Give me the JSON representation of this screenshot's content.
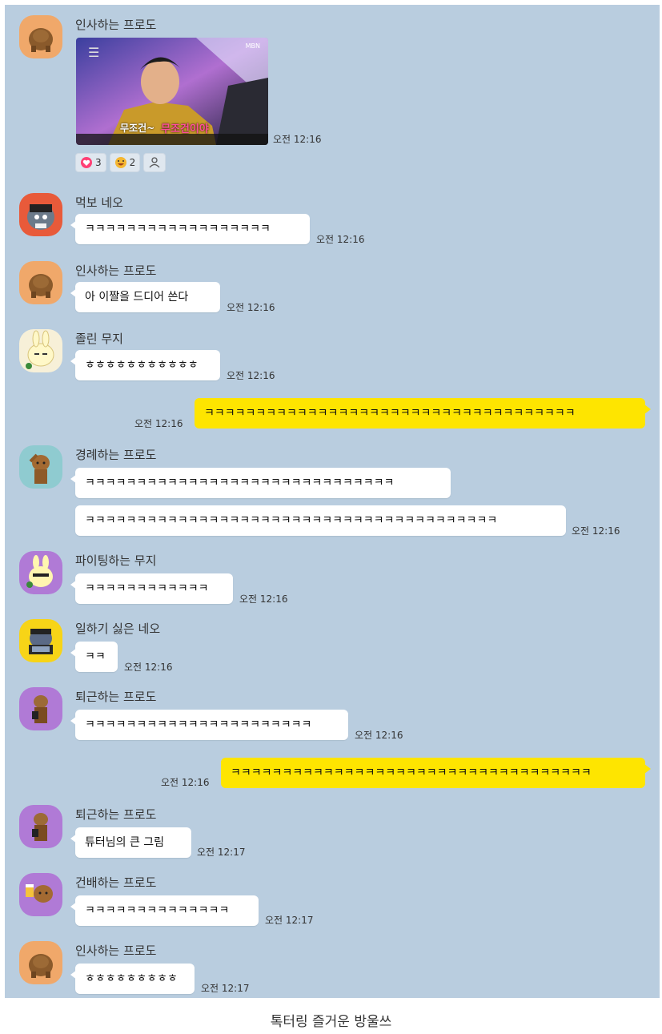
{
  "colors": {
    "chat_bg": "#b9cddf",
    "my_bubble": "#fee500",
    "other_bubble": "#ffffff"
  },
  "messages": [
    {
      "sender": "인사하는 프로도",
      "avatar": "frodo-greeting-avatar",
      "time": "오전 12:16",
      "image": {
        "caption_left": "무조건~",
        "caption_right": "무조건이야",
        "corner_badge": "MBN"
      }
    },
    {
      "sender": "먹보 네오",
      "text": "ㅋㅋㅋㅋㅋㅋㅋㅋㅋㅋㅋㅋㅋㅋㅋㅋㅋㅋ",
      "time": "오전 12:16"
    },
    {
      "sender": "인사하는 프로도",
      "text": "아 이짤을 드디어 쓴다",
      "time": "오전 12:16"
    },
    {
      "sender": "졸린 무지",
      "text": "ㅎㅎㅎㅎㅎㅎㅎㅎㅎㅎㅎ",
      "time": "오전 12:16"
    },
    {
      "mine": true,
      "text": "ㅋㅋㅋㅋㅋㅋㅋㅋㅋㅋㅋㅋㅋㅋㅋㅋㅋㅋㅋㅋㅋㅋㅋㅋㅋㅋㅋㅋㅋㅋㅋㅋㅋㅋㅋㅋ",
      "time": "오전 12:16"
    },
    {
      "sender": "경례하는 프로도",
      "text": "ㅋㅋㅋㅋㅋㅋㅋㅋㅋㅋㅋㅋㅋㅋㅋㅋㅋㅋㅋㅋㅋㅋㅋㅋㅋㅋㅋㅋㅋㅋ",
      "text2": "ㅋㅋㅋㅋㅋㅋㅋㅋㅋㅋㅋㅋㅋㅋㅋㅋㅋㅋㅋㅋㅋㅋㅋㅋㅋㅋㅋㅋㅋㅋㅋㅋㅋㅋㅋㅋㅋㅋㅋㅋ",
      "time": "오전 12:16"
    },
    {
      "sender": "파이팅하는 무지",
      "text": "ㅋㅋㅋㅋㅋㅋㅋㅋㅋㅋㅋㅋ",
      "time": "오전 12:16"
    },
    {
      "sender": "일하기 싫은 네오",
      "text": "ㅋㅋ",
      "time": "오전 12:16"
    },
    {
      "sender": "퇴근하는 프로도",
      "text": "ㅋㅋㅋㅋㅋㅋㅋㅋㅋㅋㅋㅋㅋㅋㅋㅋㅋㅋㅋㅋㅋㅋ",
      "time": "오전 12:16"
    },
    {
      "mine": true,
      "text": "ㅋㅋㅋㅋㅋㅋㅋㅋㅋㅋㅋㅋㅋㅋㅋㅋㅋㅋㅋㅋㅋㅋㅋㅋㅋㅋㅋㅋㅋㅋㅋㅋㅋㅋㅋ",
      "time": "오전 12:16"
    },
    {
      "sender": "퇴근하는 프로도",
      "text": "튜터님의 큰 그림",
      "time": "오전 12:17"
    },
    {
      "sender": "건배하는 프로도",
      "text": "ㅋㅋㅋㅋㅋㅋㅋㅋㅋㅋㅋㅋㅋㅋ",
      "time": "오전 12:17"
    },
    {
      "sender": "인사하는 프로도",
      "text": "ㅎㅎㅎㅎㅎㅎㅎㅎㅎ",
      "time": "오전 12:17"
    }
  ],
  "reactions": [
    {
      "icon": "heart-icon",
      "count": "3"
    },
    {
      "icon": "laughing-face-icon",
      "count": "2"
    },
    {
      "icon": "person-icon",
      "count": ""
    }
  ],
  "caption": "톡터링 즐거운 방울쓰"
}
